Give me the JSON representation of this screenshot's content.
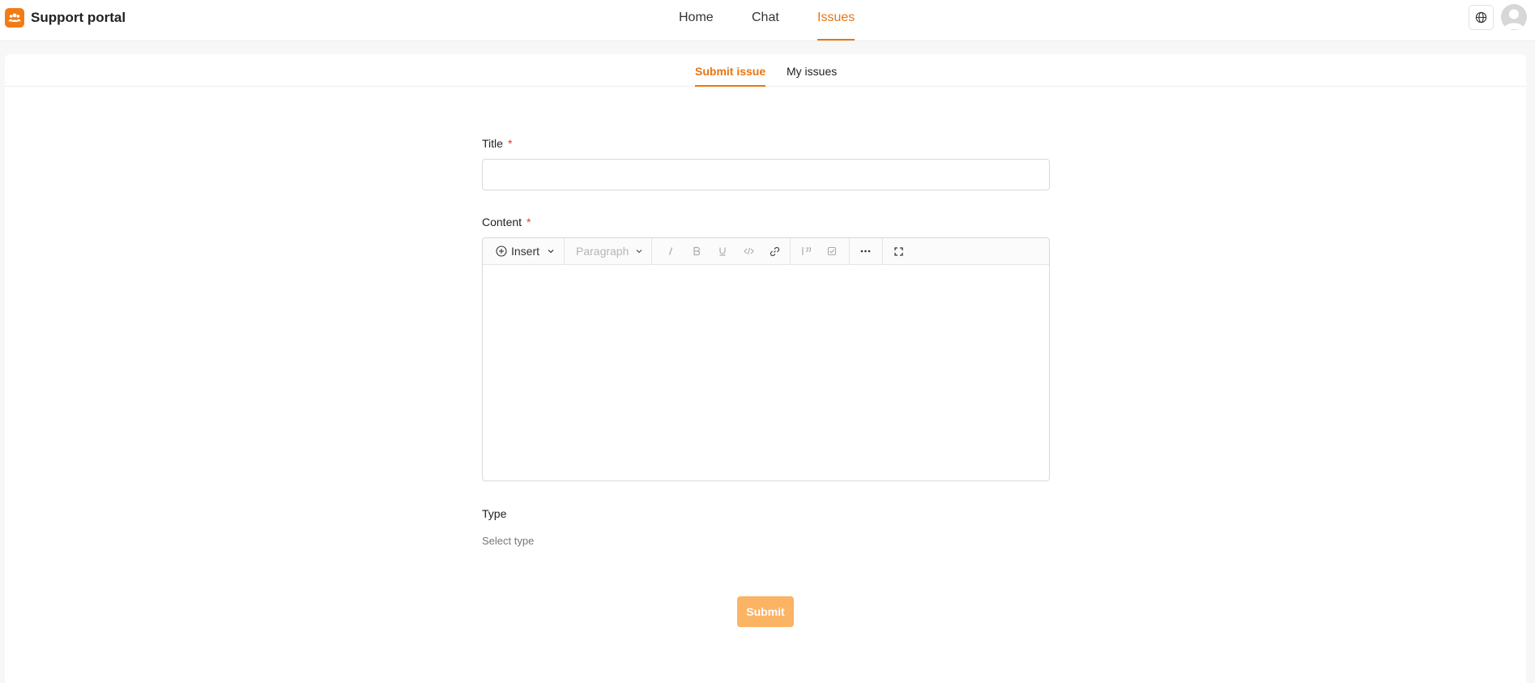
{
  "app": {
    "title": "Support portal",
    "accent": "#ea7510",
    "logo_icon": "users-icon"
  },
  "nav": {
    "items": [
      {
        "label": "Home",
        "active": false
      },
      {
        "label": "Chat",
        "active": false
      },
      {
        "label": "Issues",
        "active": true
      }
    ]
  },
  "header_actions": {
    "language_icon": "globe-icon",
    "avatar_icon": "user-avatar-icon"
  },
  "subtabs": [
    {
      "label": "Submit issue",
      "active": true
    },
    {
      "label": "My issues",
      "active": false
    }
  ],
  "form": {
    "title_label": "Title",
    "title_value": "",
    "content_label": "Content",
    "required_mark": "*",
    "editor_toolbar": {
      "insert_label": "Insert",
      "paragraph_label": "Paragraph",
      "buttons": [
        "italic-icon",
        "bold-icon",
        "underline-icon",
        "code-icon",
        "link-icon",
        "quote-icon",
        "checkbox-icon",
        "more-icon",
        "fullscreen-icon"
      ]
    },
    "type_label": "Type",
    "type_placeholder": "Select type",
    "submit_label": "Submit",
    "submit_color": "#fbb364"
  }
}
